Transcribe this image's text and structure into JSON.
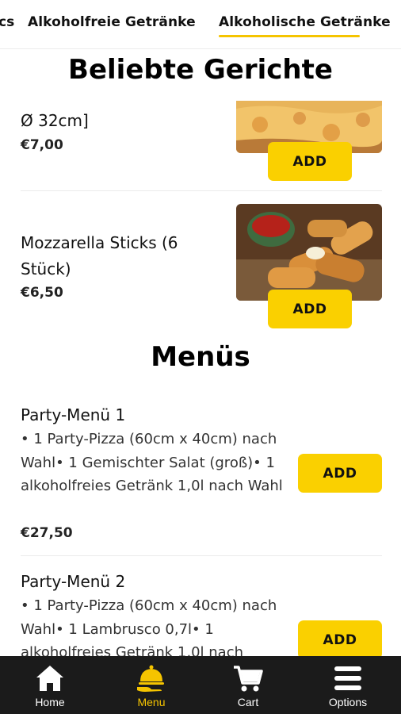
{
  "tabs": [
    {
      "label": "cs"
    },
    {
      "label": "Alkoholfreie Getränke"
    },
    {
      "label": "Alkoholische Getränke",
      "active": true
    }
  ],
  "sections": {
    "popular_title": "Beliebte Gerichte",
    "menus_title": "Menüs"
  },
  "popular": [
    {
      "name": "Ø 32cm]",
      "price": "€7,00",
      "add": "ADD"
    },
    {
      "name": "Mozzarella Sticks (6 Stück)",
      "price": "€6,50",
      "add": "ADD"
    }
  ],
  "menus": [
    {
      "name": "Party-Menü 1",
      "description": "• 1 Party-Pizza (60cm x 40cm) nach Wahl• 1 Gemischter Salat (groß)• 1 alkoholfreies Getränk 1,0l nach Wahl",
      "price": "€27,50",
      "add": "ADD"
    },
    {
      "name": "Party-Menü 2",
      "description": "• 1 Party-Pizza (60cm x 40cm) nach Wahl• 1 Lambrusco 0,7l• 1 alkoholfreies Getränk 1,0l nach",
      "add": "ADD"
    }
  ],
  "nav": [
    {
      "label": "Home",
      "icon": "home-icon"
    },
    {
      "label": "Menu",
      "icon": "cloche-icon",
      "active": true
    },
    {
      "label": "Cart",
      "icon": "cart-icon"
    },
    {
      "label": "Options",
      "icon": "hamburger-icon"
    }
  ],
  "colors": {
    "accent": "#f5c400",
    "button": "#fad000",
    "nav_bg": "#1b1b1b"
  }
}
